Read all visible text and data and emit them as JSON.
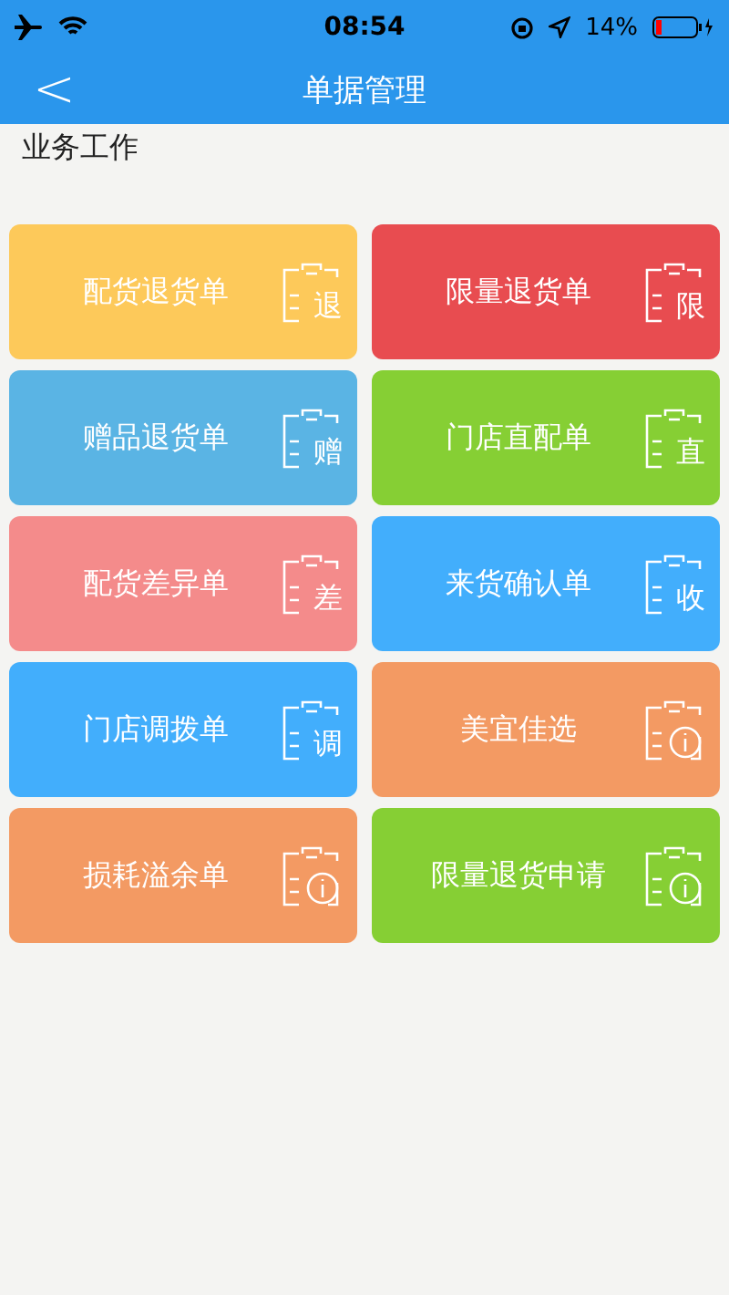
{
  "status_bar": {
    "time": "08:54",
    "battery": "14%"
  },
  "nav_bar": {
    "back": "<",
    "title": "单据管理"
  },
  "section": {
    "title": "业务工作"
  },
  "tiles": [
    {
      "label": "配货退货单",
      "color": "#fdc95a",
      "kind": "glyph",
      "glyph": "退"
    },
    {
      "label": "限量退货单",
      "color": "#e84c50",
      "kind": "glyph",
      "glyph": "限"
    },
    {
      "label": "赠品退货单",
      "color": "#5ab4e4",
      "kind": "glyph",
      "glyph": "赠"
    },
    {
      "label": "门店直配单",
      "color": "#86cf34",
      "kind": "glyph",
      "glyph": "直"
    },
    {
      "label": "配货差异单",
      "color": "#f48b8b",
      "kind": "glyph",
      "glyph": "差"
    },
    {
      "label": "来货确认单",
      "color": "#42aefc",
      "kind": "glyph",
      "glyph": "收"
    },
    {
      "label": "门店调拨单",
      "color": "#42aefc",
      "kind": "glyph",
      "glyph": "调"
    },
    {
      "label": "美宜佳选",
      "color": "#f39a63",
      "kind": "info"
    },
    {
      "label": "损耗溢余单",
      "color": "#f39a63",
      "kind": "info"
    },
    {
      "label": "限量退货申请",
      "color": "#86cf34",
      "kind": "info"
    }
  ]
}
